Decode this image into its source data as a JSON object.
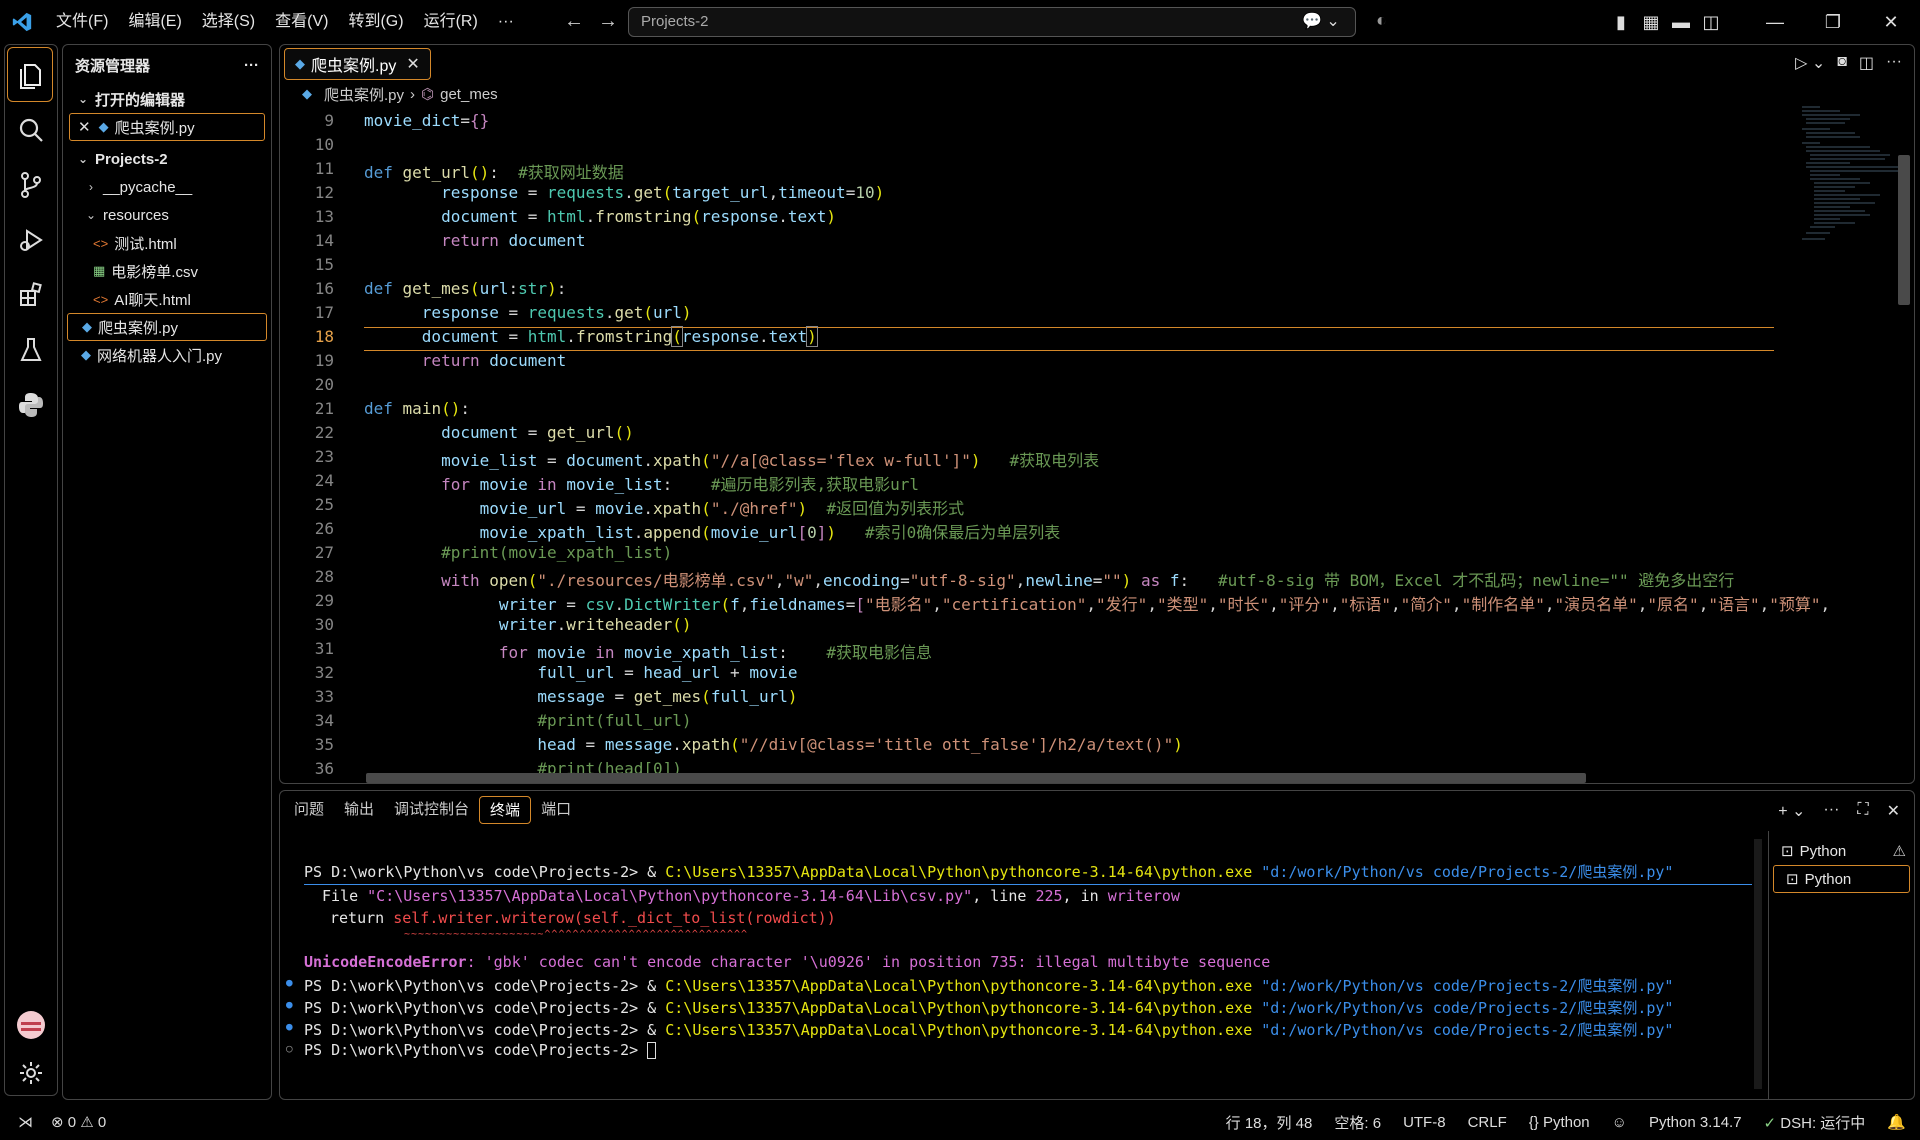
{
  "titlebar": {
    "menu": [
      "文件(F)",
      "编辑(E)",
      "选择(S)",
      "查看(V)",
      "转到(G)",
      "运行(R)",
      "···"
    ],
    "search": "Projects-2"
  },
  "sidebar": {
    "title": "资源管理器",
    "more": "···",
    "open_editors": "打开的编辑器",
    "open_file": "爬虫案例.py",
    "project": "Projects-2",
    "items": [
      {
        "label": "__pycache__",
        "type": "folder"
      },
      {
        "label": "resources",
        "type": "folder-open"
      },
      {
        "label": "测试.html",
        "type": "html"
      },
      {
        "label": "电影榜单.csv",
        "type": "csv"
      },
      {
        "label": "AI聊天.html",
        "type": "html"
      },
      {
        "label": "爬虫案例.py",
        "type": "py"
      },
      {
        "label": "网络机器人入门.py",
        "type": "py"
      }
    ]
  },
  "editor": {
    "tab": "爬虫案例.py",
    "breadcrumb": [
      "爬虫案例.py",
      "get_mes"
    ],
    "current_line": 18
  },
  "panel": {
    "tabs": [
      "问题",
      "输出",
      "调试控制台",
      "终端",
      "端口"
    ],
    "active_tab": "终端",
    "terminals": [
      "Python",
      "Python"
    ]
  },
  "terminal": {
    "prompt_cmd": "PS D:\\work\\Python\\vs code\\Projects-2> & C:\\Users\\13357\\AppData\\Local\\Python\\pythoncore-3.14-64\\python.exe \"d:/work/Python/vs code/Projects-2/爬虫案例.py\"",
    "file_line_a": "File ",
    "file_path": "\"C:\\Users\\13357\\AppData\\Local\\Python\\pythoncore-3.14-64\\Lib\\csv.py\"",
    "file_line_b": ", line ",
    "file_line_num": "225",
    "file_line_c": ", in ",
    "file_line_func": "writerow",
    "return_kw": "return ",
    "return_expr": "self.writer.writerow(self._dict_to_list(rowdict))",
    "carets": "~~~~~~~~~~~~~~~~~~~~^^^^^^^^^^^^^^^^^^^^^^^^^^^^^",
    "error_type": "UnicodeEncodeError",
    "error_msg": ": 'gbk' codec can't encode character '\\u0926' in position 735: illegal multibyte sequence",
    "prompt_only": "PS D:\\work\\Python\\vs code\\Projects-2> "
  },
  "statusbar": {
    "errors": "0",
    "warnings": "0",
    "position": "行 18，列 48",
    "spaces": "空格: 6",
    "encoding": "UTF-8",
    "eol": "CRLF",
    "language": "Python",
    "interpreter": "Python 3.14.7",
    "dsh": "DSH: 运行中"
  },
  "colors": {
    "accent": "#d4882a",
    "keyword": "#569cd6",
    "string": "#ce9178",
    "comment": "#6a9955"
  }
}
